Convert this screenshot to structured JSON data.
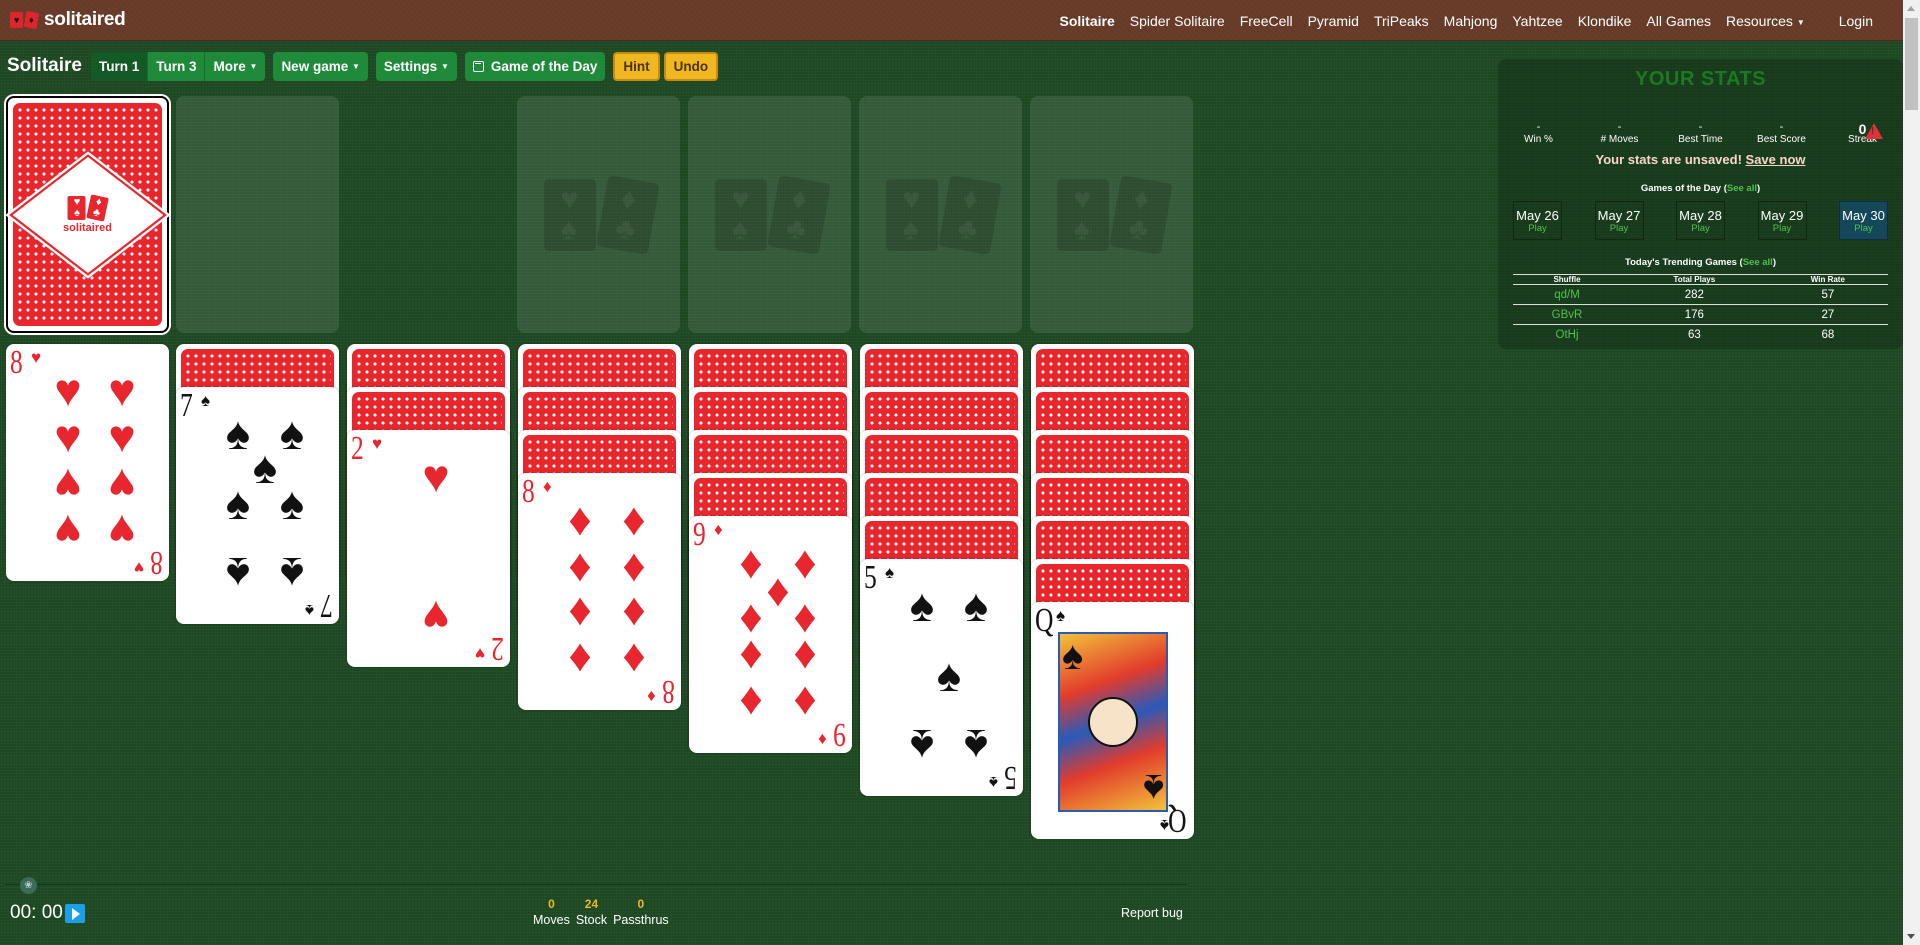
{
  "brand": {
    "name": "solitaired"
  },
  "nav": {
    "items": [
      "Solitaire",
      "Spider Solitaire",
      "FreeCell",
      "Pyramid",
      "TriPeaks",
      "Mahjong",
      "Yahtzee",
      "Klondike",
      "All Games"
    ],
    "active": "Solitaire",
    "resources_label": "Resources",
    "login_label": "Login"
  },
  "toolbar": {
    "title": "Solitaire",
    "turn1_label": "Turn 1",
    "turn3_label": "Turn 3",
    "more_label": "More",
    "new_game_label": "New game",
    "settings_label": "Settings",
    "gotd_label": "Game of the Day",
    "hint_label": "Hint",
    "undo_label": "Undo",
    "active_turn": "Turn 1"
  },
  "board": {
    "stock": {
      "count": 24,
      "back_text": "solitaired"
    },
    "waste": [],
    "foundations": [
      [],
      [],
      [],
      []
    ],
    "tableau": [
      {
        "face_down": 0,
        "face_up": [
          {
            "rank": "8",
            "suit": "hearts"
          }
        ]
      },
      {
        "face_down": 1,
        "face_up": [
          {
            "rank": "7",
            "suit": "spades"
          }
        ]
      },
      {
        "face_down": 2,
        "face_up": [
          {
            "rank": "2",
            "suit": "hearts"
          }
        ]
      },
      {
        "face_down": 3,
        "face_up": [
          {
            "rank": "8",
            "suit": "diamonds"
          }
        ]
      },
      {
        "face_down": 4,
        "face_up": [
          {
            "rank": "9",
            "suit": "diamonds"
          }
        ]
      },
      {
        "face_down": 5,
        "face_up": [
          {
            "rank": "5",
            "suit": "spades"
          }
        ]
      },
      {
        "face_down": 6,
        "face_up": [
          {
            "rank": "Q",
            "suit": "spades"
          }
        ]
      }
    ]
  },
  "stats": {
    "title": "YOUR STATS",
    "items": [
      {
        "value": "-",
        "label": "Win %"
      },
      {
        "value": "-",
        "label": "# Moves"
      },
      {
        "value": "-",
        "label": "Best Time"
      },
      {
        "value": "-",
        "label": "Best Score"
      },
      {
        "value": "0",
        "label": "Streak"
      }
    ],
    "unsaved_text": "Your stats are unsaved!",
    "save_link": "Save now",
    "gotd_title": "Games of the Day",
    "see_all": "See all",
    "gotd": [
      {
        "date": "May 26",
        "action": "Play"
      },
      {
        "date": "May 27",
        "action": "Play"
      },
      {
        "date": "May 28",
        "action": "Play"
      },
      {
        "date": "May 29",
        "action": "Play"
      },
      {
        "date": "May 30",
        "action": "Play",
        "active": true
      }
    ],
    "trending_title": "Today's Trending Games",
    "trending_headers": [
      "Shuffle",
      "Total Plays",
      "Win Rate"
    ],
    "trending": [
      {
        "shuffle": "qd/M",
        "plays": "282",
        "win_rate": "57"
      },
      {
        "shuffle": "GBvR",
        "plays": "176",
        "win_rate": "27"
      },
      {
        "shuffle": "OtHj",
        "plays": "63",
        "win_rate": "68"
      }
    ]
  },
  "footer": {
    "timer": "00: 00",
    "counters": [
      {
        "value": "0",
        "label": "Moves"
      },
      {
        "value": "24",
        "label": "Stock"
      },
      {
        "value": "0",
        "label": "Passthrus"
      }
    ],
    "report_bug": "Report bug"
  },
  "colors": {
    "felt": "#1f4a24",
    "header": "#6a3d2a",
    "button_green": "#1e8a3a",
    "button_yellow": "#f0b820",
    "card_red": "#e8262e",
    "accent_green": "#4ec24e"
  }
}
